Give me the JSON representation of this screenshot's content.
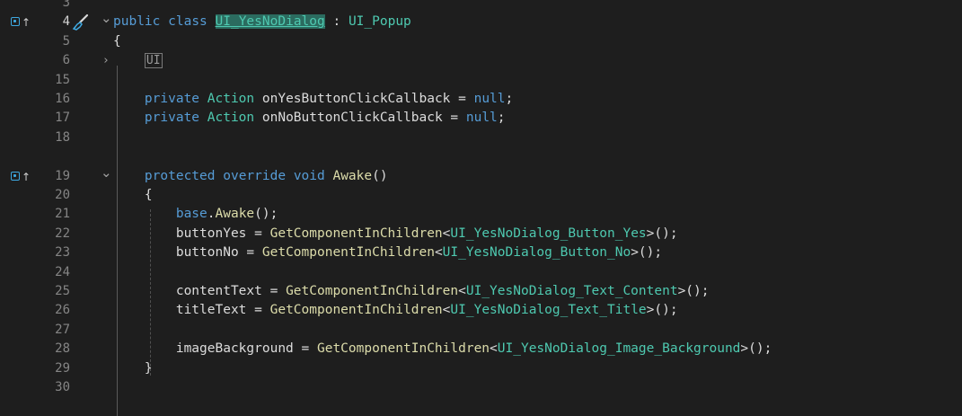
{
  "colors": {
    "background": "#1e1e1e",
    "keyword": "#569cd6",
    "type": "#4ec9b0",
    "method": "#dcdcaa",
    "text": "#dcdcdc",
    "line_number": "#858585",
    "highlight": "#2b6b5f",
    "marker": "#3ea8e0"
  },
  "icons": {
    "reference_marker": "override-marker-icon",
    "quick_action": "paintbrush-icon",
    "fold_open": "chevron-down-icon",
    "fold_closed": "chevron-right-icon"
  },
  "editor": {
    "lines": [
      {
        "num": "3",
        "tokens": []
      },
      {
        "num": "4",
        "marker": true,
        "brush": true,
        "fold": "open",
        "tokens": [
          {
            "t": "public",
            "c": "kw"
          },
          {
            "t": " ",
            "c": "id"
          },
          {
            "t": "class",
            "c": "kw"
          },
          {
            "t": " ",
            "c": "id"
          },
          {
            "t": "UI_YesNoDialog",
            "c": "hl"
          },
          {
            "t": " : ",
            "c": "id"
          },
          {
            "t": "UI_Popup",
            "c": "ty"
          }
        ]
      },
      {
        "num": "5",
        "tokens": [
          {
            "t": "{",
            "c": "id"
          }
        ]
      },
      {
        "num": "6",
        "fold": "closed",
        "tokens": [
          {
            "t": "    ",
            "c": "id"
          },
          {
            "t": "UI",
            "c": "region"
          }
        ]
      },
      {
        "num": "15",
        "tokens": []
      },
      {
        "num": "16",
        "tokens": [
          {
            "t": "    ",
            "c": "id"
          },
          {
            "t": "private",
            "c": "kw"
          },
          {
            "t": " ",
            "c": "id"
          },
          {
            "t": "Action",
            "c": "ty"
          },
          {
            "t": " onYesButtonClickCallback = ",
            "c": "id"
          },
          {
            "t": "null",
            "c": "kw"
          },
          {
            "t": ";",
            "c": "id"
          }
        ]
      },
      {
        "num": "17",
        "tokens": [
          {
            "t": "    ",
            "c": "id"
          },
          {
            "t": "private",
            "c": "kw"
          },
          {
            "t": " ",
            "c": "id"
          },
          {
            "t": "Action",
            "c": "ty"
          },
          {
            "t": " onNoButtonClickCallback = ",
            "c": "id"
          },
          {
            "t": "null",
            "c": "kw"
          },
          {
            "t": ";",
            "c": "id"
          }
        ]
      },
      {
        "num": "18",
        "tokens": []
      },
      {
        "num": "",
        "tokens": []
      },
      {
        "num": "19",
        "marker": true,
        "fold": "open",
        "tokens": [
          {
            "t": "    ",
            "c": "id"
          },
          {
            "t": "protected",
            "c": "kw"
          },
          {
            "t": " ",
            "c": "id"
          },
          {
            "t": "override",
            "c": "kw"
          },
          {
            "t": " ",
            "c": "id"
          },
          {
            "t": "void",
            "c": "kw"
          },
          {
            "t": " ",
            "c": "id"
          },
          {
            "t": "Awake",
            "c": "fn"
          },
          {
            "t": "()",
            "c": "id"
          }
        ]
      },
      {
        "num": "20",
        "tokens": [
          {
            "t": "    {",
            "c": "id"
          }
        ]
      },
      {
        "num": "21",
        "tokens": [
          {
            "t": "        ",
            "c": "id"
          },
          {
            "t": "base",
            "c": "kw"
          },
          {
            "t": ".",
            "c": "id"
          },
          {
            "t": "Awake",
            "c": "fn"
          },
          {
            "t": "();",
            "c": "id"
          }
        ]
      },
      {
        "num": "22",
        "tokens": [
          {
            "t": "        buttonYes = ",
            "c": "id"
          },
          {
            "t": "GetComponentInChildren",
            "c": "fn"
          },
          {
            "t": "<",
            "c": "id"
          },
          {
            "t": "UI_YesNoDialog_Button_Yes",
            "c": "ty"
          },
          {
            "t": ">();",
            "c": "id"
          }
        ]
      },
      {
        "num": "23",
        "tokens": [
          {
            "t": "        buttonNo = ",
            "c": "id"
          },
          {
            "t": "GetComponentInChildren",
            "c": "fn"
          },
          {
            "t": "<",
            "c": "id"
          },
          {
            "t": "UI_YesNoDialog_Button_No",
            "c": "ty"
          },
          {
            "t": ">();",
            "c": "id"
          }
        ]
      },
      {
        "num": "24",
        "tokens": []
      },
      {
        "num": "25",
        "tokens": [
          {
            "t": "        contentText = ",
            "c": "id"
          },
          {
            "t": "GetComponentInChildren",
            "c": "fn"
          },
          {
            "t": "<",
            "c": "id"
          },
          {
            "t": "UI_YesNoDialog_Text_Content",
            "c": "ty"
          },
          {
            "t": ">();",
            "c": "id"
          }
        ]
      },
      {
        "num": "26",
        "tokens": [
          {
            "t": "        titleText = ",
            "c": "id"
          },
          {
            "t": "GetComponentInChildren",
            "c": "fn"
          },
          {
            "t": "<",
            "c": "id"
          },
          {
            "t": "UI_YesNoDialog_Text_Title",
            "c": "ty"
          },
          {
            "t": ">();",
            "c": "id"
          }
        ]
      },
      {
        "num": "27",
        "tokens": []
      },
      {
        "num": "28",
        "tokens": [
          {
            "t": "        imageBackground = ",
            "c": "id"
          },
          {
            "t": "GetComponentInChildren",
            "c": "fn"
          },
          {
            "t": "<",
            "c": "id"
          },
          {
            "t": "UI_YesNoDialog_Image_Background",
            "c": "ty"
          },
          {
            "t": ">();",
            "c": "id"
          }
        ]
      },
      {
        "num": "29",
        "tokens": [
          {
            "t": "    }",
            "c": "id"
          }
        ]
      },
      {
        "num": "30",
        "tokens": []
      }
    ]
  }
}
